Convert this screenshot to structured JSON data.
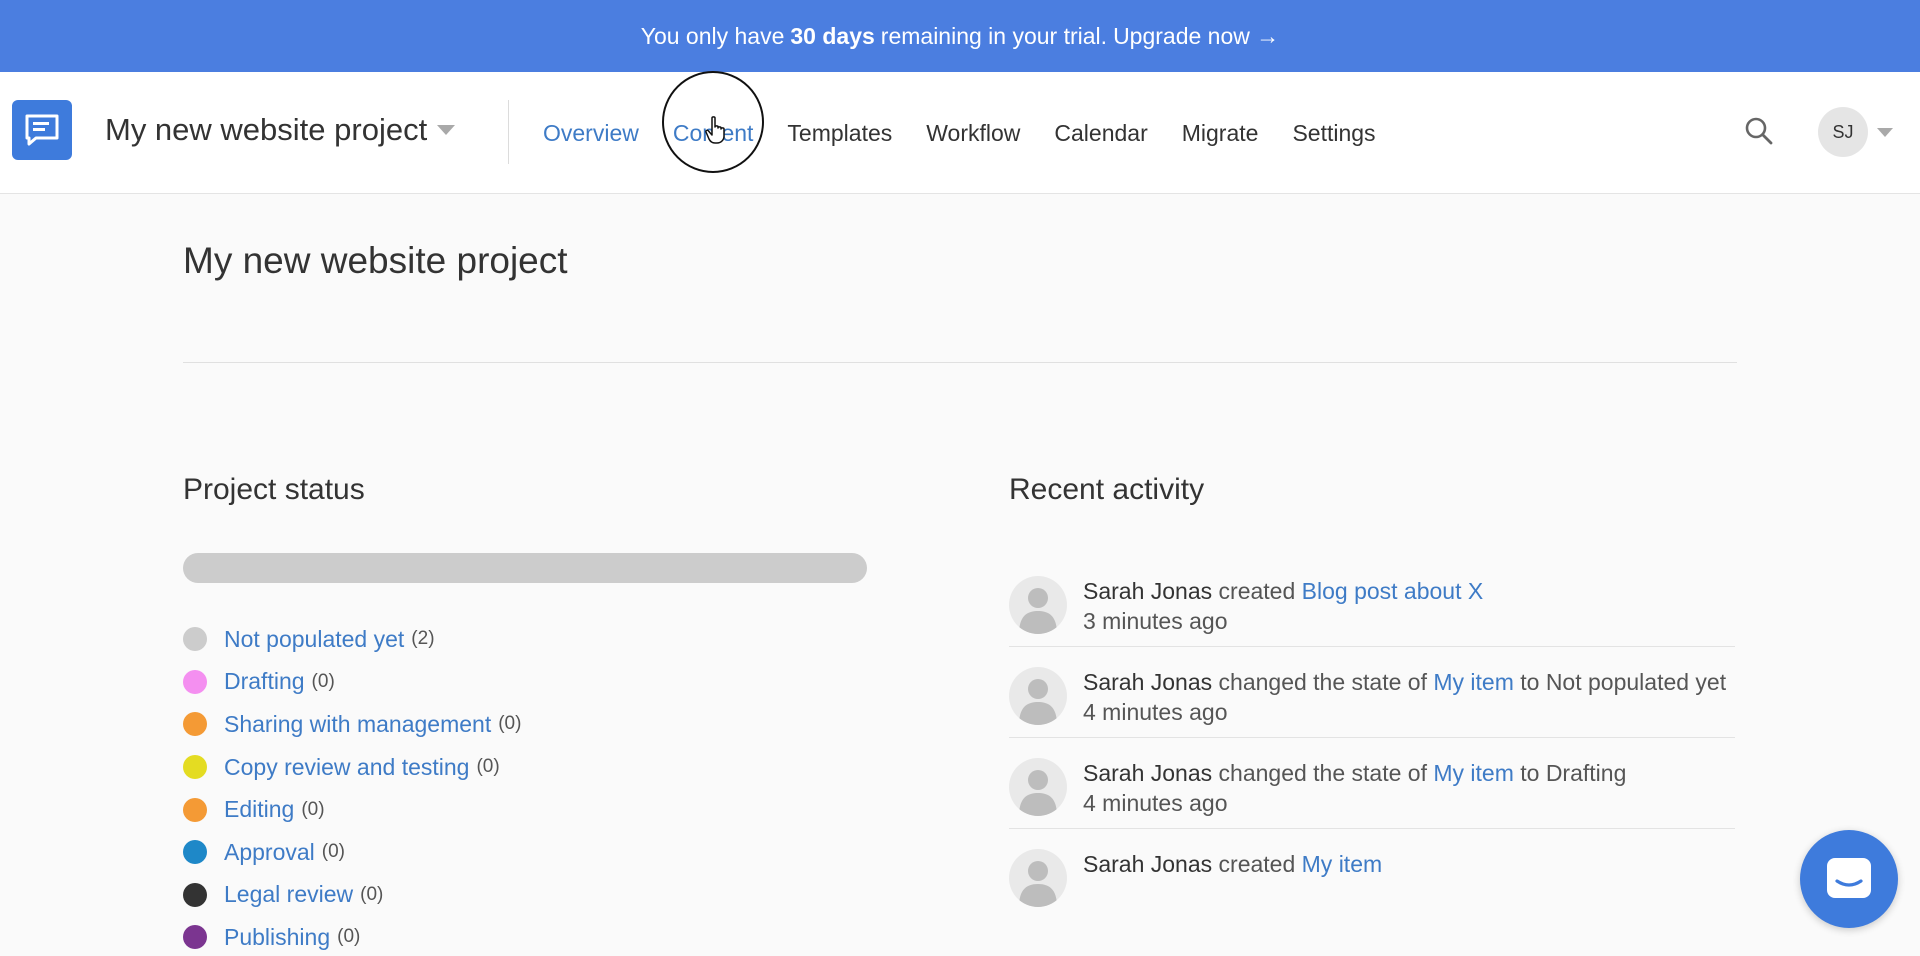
{
  "banner": {
    "prefix": "You only have",
    "days": "30 days",
    "middle": "remaining in your trial.",
    "cta": "Upgrade now →"
  },
  "header": {
    "project_name": "My new website project",
    "nav": [
      "Overview",
      "Content",
      "Templates",
      "Workflow",
      "Calendar",
      "Migrate",
      "Settings"
    ],
    "active_nav": "Overview",
    "user_initials": "SJ"
  },
  "page": {
    "title": "My new website project"
  },
  "project_status": {
    "title": "Project status",
    "items": [
      {
        "label": "Not populated yet",
        "count": "(2)",
        "color": "#cccccc"
      },
      {
        "label": "Drafting",
        "count": "(0)",
        "color": "#f48ff0"
      },
      {
        "label": "Sharing with management",
        "count": "(0)",
        "color": "#f49a35"
      },
      {
        "label": "Copy review and testing",
        "count": "(0)",
        "color": "#e4dc22"
      },
      {
        "label": "Editing",
        "count": "(0)",
        "color": "#f49a35"
      },
      {
        "label": "Approval",
        "count": "(0)",
        "color": "#1e88c8"
      },
      {
        "label": "Legal review",
        "count": "(0)",
        "color": "#333333"
      },
      {
        "label": "Publishing",
        "count": "(0)",
        "color": "#7b3590"
      }
    ]
  },
  "recent_activity": {
    "title": "Recent activity",
    "items": [
      {
        "user": "Sarah Jonas",
        "action": "created",
        "target": "Blog post about X",
        "suffix": "",
        "time": "3 minutes ago"
      },
      {
        "user": "Sarah Jonas",
        "action": "changed the state of",
        "target": "My item",
        "suffix": "to Not populated yet",
        "time": "4 minutes ago"
      },
      {
        "user": "Sarah Jonas",
        "action": "changed the state of",
        "target": "My item",
        "suffix": "to Drafting",
        "time": "4 minutes ago"
      },
      {
        "user": "Sarah Jonas",
        "action": "created",
        "target": "My item",
        "suffix": "",
        "time": ""
      }
    ]
  },
  "colors": {
    "banner": "#4b7ee0",
    "accent": "#3e7bc6",
    "logo": "#3e7bdc"
  }
}
